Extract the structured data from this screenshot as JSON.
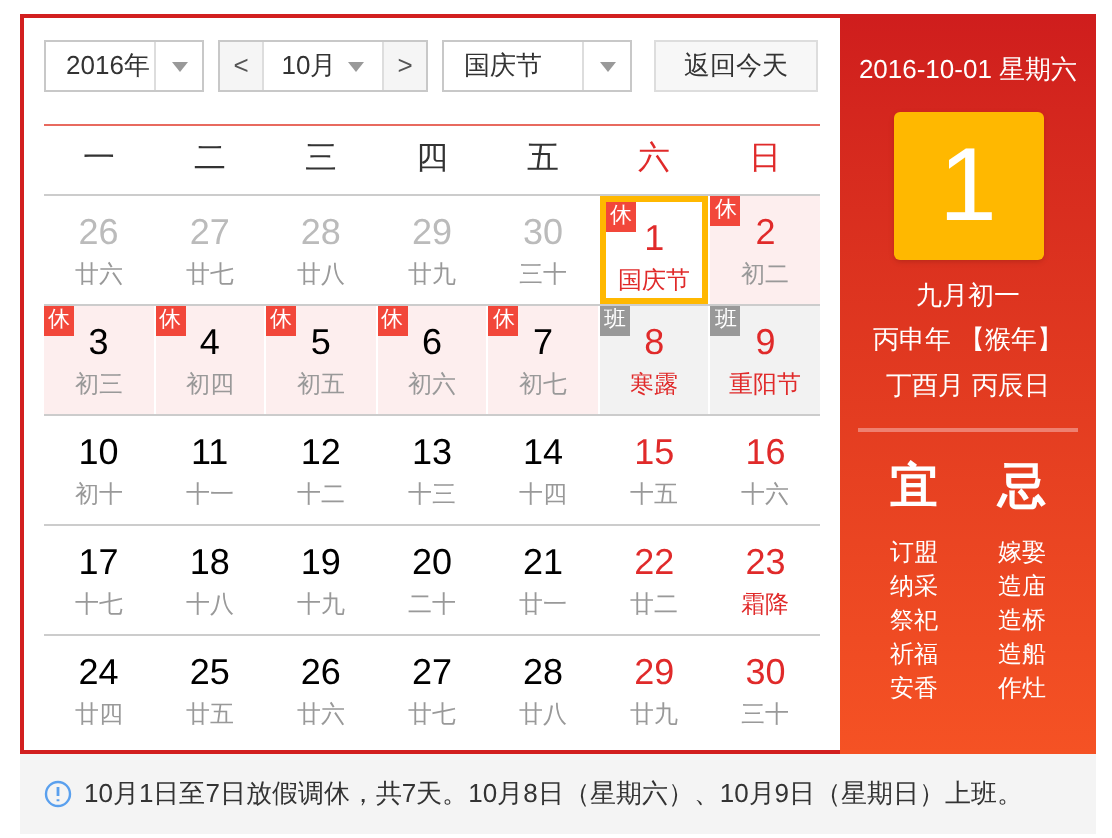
{
  "controls": {
    "year": "2016年",
    "month": "10月",
    "prev": "<",
    "next": ">",
    "holiday": "国庆节",
    "today_button": "返回今天"
  },
  "weekdays": [
    {
      "label": "一",
      "weekend": false
    },
    {
      "label": "二",
      "weekend": false
    },
    {
      "label": "三",
      "weekend": false
    },
    {
      "label": "四",
      "weekend": false
    },
    {
      "label": "五",
      "weekend": false
    },
    {
      "label": "六",
      "weekend": true
    },
    {
      "label": "日",
      "weekend": true
    }
  ],
  "weeks": [
    [
      {
        "day": "26",
        "lunar": "廿六",
        "in_month": false,
        "festival": false,
        "selected": false
      },
      {
        "day": "27",
        "lunar": "廿七",
        "in_month": false,
        "festival": false,
        "selected": false
      },
      {
        "day": "28",
        "lunar": "廿八",
        "in_month": false,
        "festival": false,
        "selected": false
      },
      {
        "day": "29",
        "lunar": "廿九",
        "in_month": false,
        "festival": false,
        "selected": false
      },
      {
        "day": "30",
        "lunar": "三十",
        "in_month": false,
        "festival": false,
        "selected": false
      },
      {
        "day": "1",
        "lunar": "国庆节",
        "in_month": true,
        "weekend": true,
        "festival": true,
        "selected": true,
        "badge": {
          "text": "休",
          "kind": "rest"
        }
      },
      {
        "day": "2",
        "lunar": "初二",
        "in_month": true,
        "weekend": true,
        "festival": false,
        "selected": false,
        "badge": {
          "text": "休",
          "kind": "rest"
        }
      }
    ],
    [
      {
        "day": "3",
        "lunar": "初三",
        "in_month": true,
        "weekend": false,
        "festival": false,
        "selected": false,
        "badge": {
          "text": "休",
          "kind": "rest"
        }
      },
      {
        "day": "4",
        "lunar": "初四",
        "in_month": true,
        "weekend": false,
        "festival": false,
        "selected": false,
        "badge": {
          "text": "休",
          "kind": "rest"
        }
      },
      {
        "day": "5",
        "lunar": "初五",
        "in_month": true,
        "weekend": false,
        "festival": false,
        "selected": false,
        "badge": {
          "text": "休",
          "kind": "rest"
        }
      },
      {
        "day": "6",
        "lunar": "初六",
        "in_month": true,
        "weekend": false,
        "festival": false,
        "selected": false,
        "badge": {
          "text": "休",
          "kind": "rest"
        }
      },
      {
        "day": "7",
        "lunar": "初七",
        "in_month": true,
        "weekend": false,
        "festival": false,
        "selected": false,
        "badge": {
          "text": "休",
          "kind": "rest"
        }
      },
      {
        "day": "8",
        "lunar": "寒露",
        "in_month": true,
        "weekend": true,
        "festival": true,
        "selected": false,
        "badge": {
          "text": "班",
          "kind": "work"
        }
      },
      {
        "day": "9",
        "lunar": "重阳节",
        "in_month": true,
        "weekend": true,
        "festival": true,
        "selected": false,
        "badge": {
          "text": "班",
          "kind": "work"
        }
      }
    ],
    [
      {
        "day": "10",
        "lunar": "初十",
        "in_month": true,
        "weekend": false,
        "festival": false,
        "selected": false
      },
      {
        "day": "11",
        "lunar": "十一",
        "in_month": true,
        "weekend": false,
        "festival": false,
        "selected": false
      },
      {
        "day": "12",
        "lunar": "十二",
        "in_month": true,
        "weekend": false,
        "festival": false,
        "selected": false
      },
      {
        "day": "13",
        "lunar": "十三",
        "in_month": true,
        "weekend": false,
        "festival": false,
        "selected": false
      },
      {
        "day": "14",
        "lunar": "十四",
        "in_month": true,
        "weekend": false,
        "festival": false,
        "selected": false
      },
      {
        "day": "15",
        "lunar": "十五",
        "in_month": true,
        "weekend": true,
        "festival": false,
        "selected": false
      },
      {
        "day": "16",
        "lunar": "十六",
        "in_month": true,
        "weekend": true,
        "festival": false,
        "selected": false
      }
    ],
    [
      {
        "day": "17",
        "lunar": "十七",
        "in_month": true,
        "weekend": false,
        "festival": false,
        "selected": false
      },
      {
        "day": "18",
        "lunar": "十八",
        "in_month": true,
        "weekend": false,
        "festival": false,
        "selected": false
      },
      {
        "day": "19",
        "lunar": "十九",
        "in_month": true,
        "weekend": false,
        "festival": false,
        "selected": false
      },
      {
        "day": "20",
        "lunar": "二十",
        "in_month": true,
        "weekend": false,
        "festival": false,
        "selected": false
      },
      {
        "day": "21",
        "lunar": "廿一",
        "in_month": true,
        "weekend": false,
        "festival": false,
        "selected": false
      },
      {
        "day": "22",
        "lunar": "廿二",
        "in_month": true,
        "weekend": true,
        "festival": false,
        "selected": false
      },
      {
        "day": "23",
        "lunar": "霜降",
        "in_month": true,
        "weekend": true,
        "festival": true,
        "selected": false
      }
    ],
    [
      {
        "day": "24",
        "lunar": "廿四",
        "in_month": true,
        "weekend": false,
        "festival": false,
        "selected": false
      },
      {
        "day": "25",
        "lunar": "廿五",
        "in_month": true,
        "weekend": false,
        "festival": false,
        "selected": false
      },
      {
        "day": "26",
        "lunar": "廿六",
        "in_month": true,
        "weekend": false,
        "festival": false,
        "selected": false
      },
      {
        "day": "27",
        "lunar": "廿七",
        "in_month": true,
        "weekend": false,
        "festival": false,
        "selected": false
      },
      {
        "day": "28",
        "lunar": "廿八",
        "in_month": true,
        "weekend": false,
        "festival": false,
        "selected": false
      },
      {
        "day": "29",
        "lunar": "廿九",
        "in_month": true,
        "weekend": true,
        "festival": false,
        "selected": false
      },
      {
        "day": "30",
        "lunar": "三十",
        "in_month": true,
        "weekend": true,
        "festival": false,
        "selected": false
      }
    ]
  ],
  "detail": {
    "date": "2016-10-01 星期六",
    "day": "1",
    "lunar_lines": [
      "九月初一",
      "丙申年 【猴年】",
      "丁酉月 丙辰日"
    ],
    "good_title": "宜",
    "good": [
      "订盟",
      "纳采",
      "祭祀",
      "祈福",
      "安香"
    ],
    "bad_title": "忌",
    "bad": [
      "嫁娶",
      "造庙",
      "造桥",
      "造船",
      "作灶"
    ]
  },
  "notice": "10月1日至7日放假调休，共7天。10月8日（星期六）、10月9日（星期日）上班。"
}
